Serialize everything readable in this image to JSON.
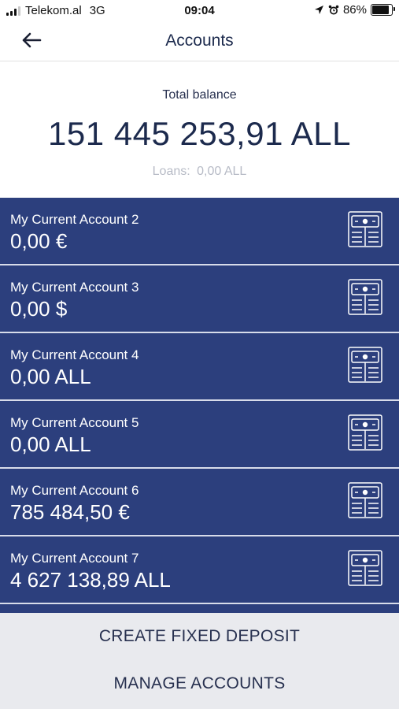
{
  "status_bar": {
    "carrier": "Telekom.al",
    "network": "3G",
    "time": "09:04",
    "battery_text": "86%",
    "battery_level": 0.86
  },
  "nav": {
    "title": "Accounts",
    "back_icon": "arrow-left-icon"
  },
  "balance": {
    "label": "Total balance",
    "amount": "151 445 253,91 ALL",
    "loans_label": "Loans:",
    "loans_value": "0,00 ALL"
  },
  "accounts": [
    {
      "name": "My Current Account 2",
      "balance": "0,00 €"
    },
    {
      "name": "My Current Account 3",
      "balance": "0,00 $"
    },
    {
      "name": "My Current Account 4",
      "balance": "0,00 ALL"
    },
    {
      "name": "My Current Account 5",
      "balance": "0,00 ALL"
    },
    {
      "name": "My Current Account 6",
      "balance": "785 484,50 €"
    },
    {
      "name": "My Current Account 7",
      "balance": "4 627 138,89 ALL"
    }
  ],
  "actions": {
    "create_label": "CREATE FIXED DEPOSIT",
    "manage_label": "MANAGE ACCOUNTS"
  },
  "colors": {
    "account_bg": "#2c3f7d",
    "title_text": "#1c2a4d",
    "bottom_bg": "#e9eaee"
  },
  "icons": {
    "account_icon": "banknote-stack-icon"
  }
}
